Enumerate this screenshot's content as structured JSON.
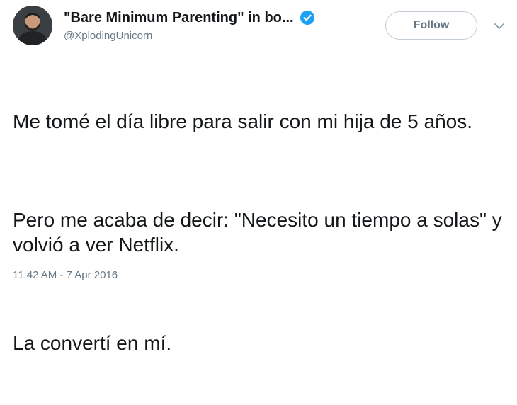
{
  "author": {
    "display_name": "\"Bare Minimum Parenting\" in bo...",
    "handle": "@XplodingUnicorn",
    "verified": true,
    "avatar_icon": "user-avatar-photo"
  },
  "actions": {
    "follow_label": "Follow",
    "more_icon": "chevron-down-icon"
  },
  "tweet": {
    "paragraphs": [
      "Me tomé el día libre para salir con mi hija de 5 años.",
      "Pero me acaba de decir: \"Necesito un tiempo a solas\" y volvió a ver Netflix.",
      "La convertí en mí."
    ],
    "timestamp": "11:42 AM - 7 Apr 2016"
  },
  "colors": {
    "text": "#14171a",
    "secondary": "#657786",
    "verified_blue": "#1da1f2",
    "border": "#c4cdd5"
  }
}
